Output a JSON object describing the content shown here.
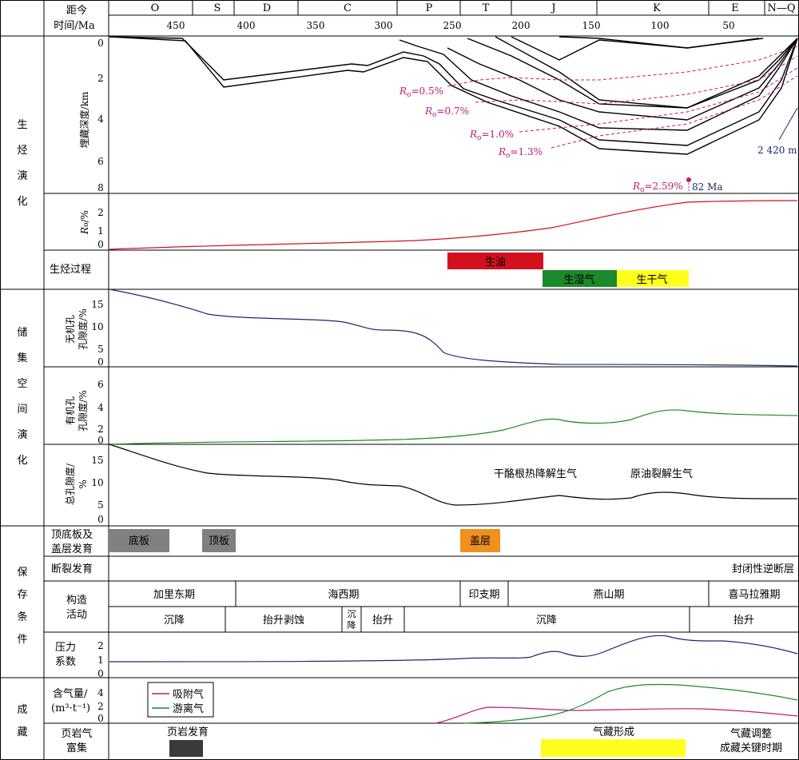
{
  "header": {
    "distance_label": "距今",
    "time_label": "时间/Ma",
    "periods": [
      "O",
      "S",
      "D",
      "C",
      "P",
      "T",
      "J",
      "K",
      "E",
      "N—Q"
    ],
    "ticks": [
      "450",
      "400",
      "350",
      "300",
      "250",
      "200",
      "150",
      "100",
      "50"
    ]
  },
  "sections": {
    "gen_chars": [
      "生",
      "烃",
      "演",
      "化"
    ],
    "res_chars": [
      "储",
      "集",
      "空",
      "间",
      "演",
      "化"
    ],
    "pres_chars": [
      "保",
      "存",
      "条",
      "件"
    ],
    "acc_chars": [
      "成",
      "藏"
    ]
  },
  "burial": {
    "ylabel": "埋藏深度/km",
    "yticks": [
      "0",
      "2",
      "4",
      "6",
      "8"
    ],
    "ro_labels": [
      {
        "r": "R",
        "sub": "o",
        "val": "=0.5%"
      },
      {
        "r": "R",
        "sub": "o",
        "val": "=0.7%"
      },
      {
        "r": "R",
        "sub": "o",
        "val": "=1.0%"
      },
      {
        "r": "R",
        "sub": "o",
        "val": "=1.3%"
      },
      {
        "r": "R",
        "sub": "o",
        "val": "=2.59%"
      }
    ],
    "age_label": "82 Ma",
    "depth_label": "2 420 m"
  },
  "ro_panel": {
    "ylabel_r": "R",
    "ylabel_sub": "o",
    "ylabel_rest": "/%",
    "yticks": [
      "2",
      "1",
      "0"
    ]
  },
  "gen_process": {
    "label": "生烃过程",
    "bars": [
      {
        "text": "生油",
        "color": "#d4101e"
      },
      {
        "text": "生湿气",
        "color": "#1b8a2a"
      },
      {
        "text": "生干气",
        "color": "#ffff1e"
      }
    ]
  },
  "inorganic": {
    "ylabel1": "无机孔",
    "ylabel2": "孔隙度/%",
    "yticks": [
      "15",
      "10",
      "5",
      "0"
    ]
  },
  "organic": {
    "ylabel1": "有机孔",
    "ylabel2": "孔隙度/%",
    "yticks": [
      "6",
      "4",
      "2",
      "0"
    ]
  },
  "total": {
    "ylabel1": "总孔隙度/",
    "ylabel2": "%",
    "yticks": [
      "15",
      "10",
      "5",
      "0"
    ],
    "ann1": "干酪根热降解生气",
    "ann2": "原油裂解生气"
  },
  "preservation": {
    "row1_label1": "顶底板及",
    "row1_label2": "盖层发育",
    "row1_boxes": [
      {
        "text": "底板",
        "color": "#808080"
      },
      {
        "text": "顶板",
        "color": "#808080"
      },
      {
        "text": "盖层",
        "color": "#f0901e"
      }
    ],
    "row2_label": "断裂发育",
    "row2_text": "封闭性逆断层",
    "tect_label1": "构造",
    "tect_label2": "活动",
    "tect_phases": [
      "加里东期",
      "海西期",
      "印支期",
      "燕山期",
      "喜马拉雅期"
    ],
    "tect_moves": [
      "沉降",
      "抬升剥蚀",
      "沉",
      "降",
      "抬升",
      "沉降",
      "抬升"
    ],
    "pressure_label1": "压力",
    "pressure_label2": "系数",
    "pressure_yticks": [
      "2",
      "1",
      "0"
    ]
  },
  "accumulation": {
    "gas_label1": "含气量/",
    "gas_label2": "(m³·t⁻¹)",
    "gas_yticks": [
      "4",
      "2",
      "0"
    ],
    "legend": [
      {
        "name": "吸附气",
        "color": "#c21a6b"
      },
      {
        "name": "游离气",
        "color": "#1b8a2a"
      }
    ],
    "rich_label1": "页岩气",
    "rich_label2": "富集",
    "stage1": "页岩发育",
    "stage2": "气藏形成",
    "stage3a": "气藏调整",
    "stage3b": "成藏关键时期",
    "colors": {
      "shale": "#3a3a3a",
      "form": "#ffff1e"
    }
  },
  "colors": {
    "burial": "#000000",
    "iso": "#c21a6b",
    "ro": "#d4101e",
    "inorganic": "#1a2a6b",
    "organic": "#1b8a2a",
    "pressure": "#1a2a6b"
  }
}
